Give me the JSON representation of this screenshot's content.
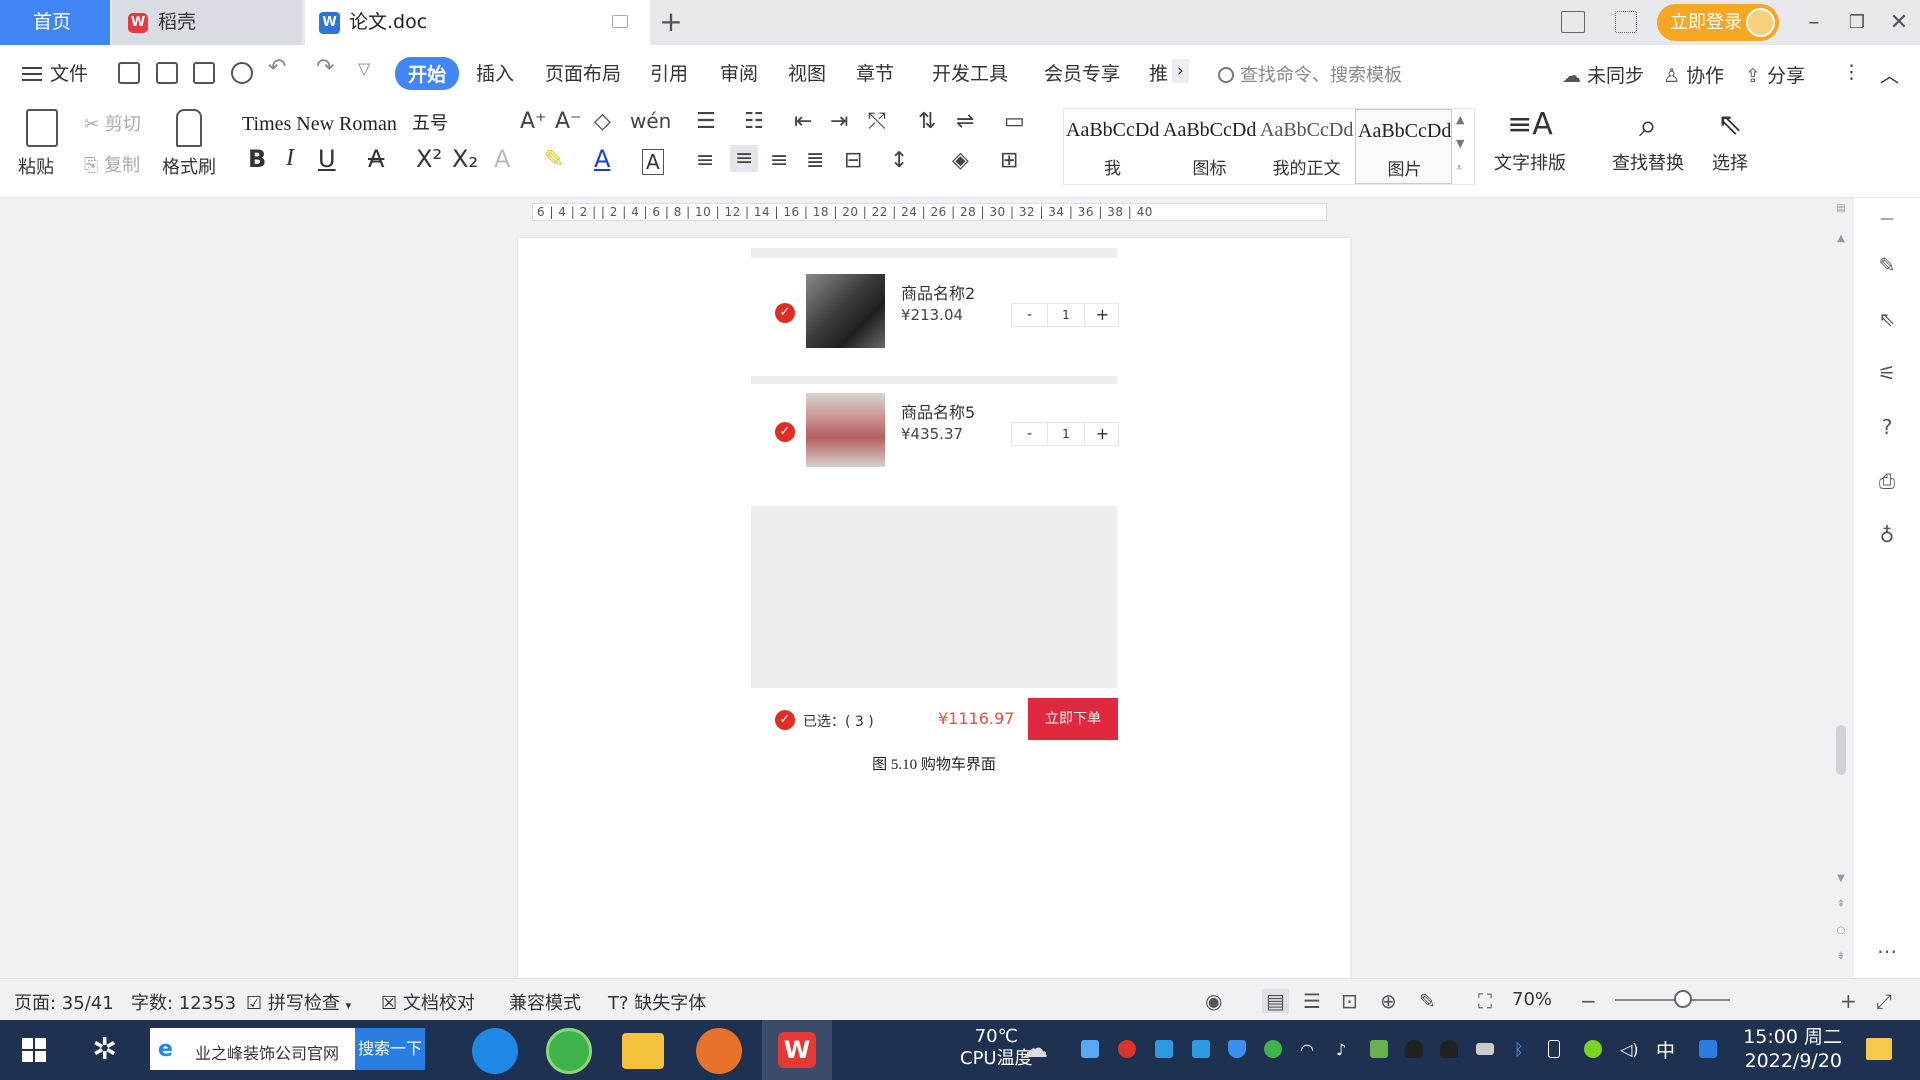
{
  "tabs": {
    "home": "首页",
    "daoke": "稻壳",
    "doc": "论文.doc",
    "new_tab": "+"
  },
  "topbar": {
    "login": "立即登录"
  },
  "menu": {
    "file": "文件",
    "tabs": [
      "开始",
      "插入",
      "页面布局",
      "引用",
      "审阅",
      "视图",
      "章节",
      "开发工具",
      "会员专享",
      "推"
    ],
    "more": "›",
    "search_placeholder": "查找命令、搜索模板",
    "sync": "未同步",
    "collab": "协作",
    "share": "分享"
  },
  "ribbon": {
    "paste": "粘贴",
    "cut": "剪切",
    "copy": "复制",
    "format_painter": "格式刷",
    "font_name": "Times New Roman",
    "font_size": "五号",
    "bold": "B",
    "italic": "I",
    "underline": "U",
    "styles": [
      {
        "preview": "AaBbCcDd",
        "name": "我"
      },
      {
        "preview": "AaBbCcDd",
        "name": "图标"
      },
      {
        "preview": "AaBbCcDd",
        "name": "我的正文"
      },
      {
        "preview": "AaBbCcDd",
        "name": "图片"
      }
    ],
    "text_layout": "文字排版",
    "find_replace": "查找替换",
    "select": "选择"
  },
  "ruler": {
    "marks": "6 | 4 | 2 |  | 2 | 4 | 6 | 8 | 10 | 12 | 14 | 16 | 18 | 20 | 22 | 24 | 26 | 28 | 30 | 32 | 34 | 36 | 38 | 40"
  },
  "cart": {
    "items": [
      {
        "name": "商品名称2",
        "price": "¥213.04",
        "qty": "1"
      },
      {
        "name": "商品名称5",
        "price": "¥435.37",
        "qty": "1"
      }
    ],
    "minus": "-",
    "plus": "+",
    "selected": "已选：( 3 )",
    "total": "¥1116.97",
    "order_button": "立即下单",
    "caption": "图 5.10 购物车界面"
  },
  "status": {
    "page": "页面: 35/41",
    "words": "字数: 12353",
    "spell": "拼写检查",
    "proof": "文档校对",
    "compat": "兼容模式",
    "missing_font": "缺失字体",
    "zoom": "70%"
  },
  "taskbar": {
    "search_text": "业之峰装饰公司官网",
    "search_button": "搜索一下",
    "temp": "70℃",
    "temp_label": "CPU温度",
    "ime": "中",
    "time": "15:00 周二",
    "date": "2022/9/20"
  },
  "colors": {
    "accent": "#4285f4",
    "cart_red": "#e02e24",
    "price_orange": "#e7513f",
    "login_orange": "#f5a623",
    "taskbar": "#1f3150"
  }
}
